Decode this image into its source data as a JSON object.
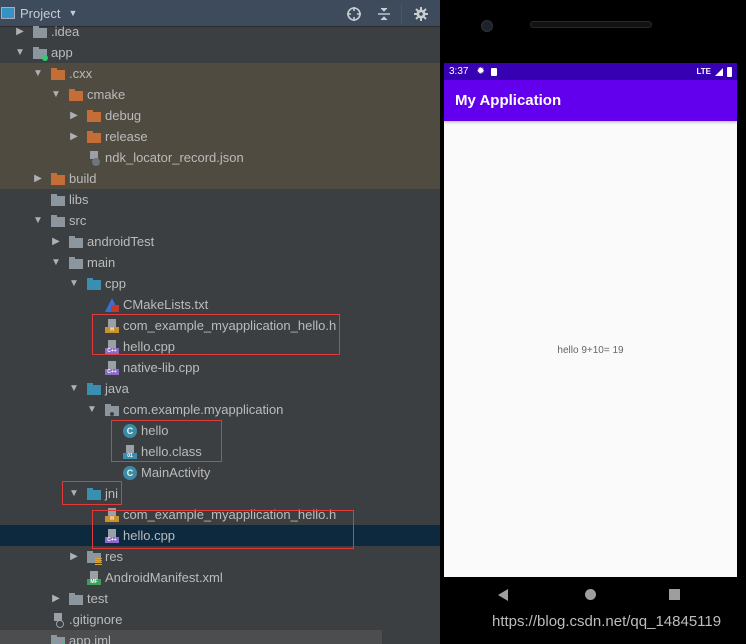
{
  "project_panel": {
    "title": "Project",
    "tools": [
      "locate-icon",
      "collapse-all-icon",
      "settings-icon"
    ]
  },
  "tree": [
    {
      "label": ".idea",
      "depth": 1,
      "arrow": "collapsed",
      "icon": "folder-gray",
      "bg": "normal"
    },
    {
      "label": "app",
      "depth": 1,
      "arrow": "expanded",
      "icon": "module-folder",
      "bg": "normal"
    },
    {
      "label": ".cxx",
      "depth": 2,
      "arrow": "expanded",
      "icon": "folder-orange",
      "bg": "excluded"
    },
    {
      "label": "cmake",
      "depth": 3,
      "arrow": "expanded",
      "icon": "folder-orange",
      "bg": "excluded"
    },
    {
      "label": "debug",
      "depth": 4,
      "arrow": "collapsed",
      "icon": "folder-orange",
      "bg": "excluded"
    },
    {
      "label": "release",
      "depth": 4,
      "arrow": "collapsed",
      "icon": "folder-orange",
      "bg": "excluded"
    },
    {
      "label": "ndk_locator_record.json",
      "depth": 4,
      "arrow": "none",
      "icon": "json-file",
      "bg": "excluded"
    },
    {
      "label": "build",
      "depth": 2,
      "arrow": "collapsed",
      "icon": "folder-orange",
      "bg": "excluded"
    },
    {
      "label": "libs",
      "depth": 2,
      "arrow": "none",
      "icon": "folder-gray",
      "bg": "normal"
    },
    {
      "label": "src",
      "depth": 2,
      "arrow": "expanded",
      "icon": "folder-gray",
      "bg": "normal"
    },
    {
      "label": "androidTest",
      "depth": 3,
      "arrow": "collapsed",
      "icon": "folder-gray",
      "bg": "normal"
    },
    {
      "label": "main",
      "depth": 3,
      "arrow": "expanded",
      "icon": "folder-gray",
      "bg": "normal"
    },
    {
      "label": "cpp",
      "depth": 4,
      "arrow": "expanded",
      "icon": "folder-blue",
      "bg": "normal"
    },
    {
      "label": "CMakeLists.txt",
      "depth": 5,
      "arrow": "none",
      "icon": "cmake-file",
      "bg": "normal"
    },
    {
      "label": "com_example_myapplication_hello.h",
      "depth": 5,
      "arrow": "none",
      "icon": "h-file",
      "bg": "normal"
    },
    {
      "label": "hello.cpp",
      "depth": 5,
      "arrow": "none",
      "icon": "cpp-file",
      "bg": "normal"
    },
    {
      "label": "native-lib.cpp",
      "depth": 5,
      "arrow": "none",
      "icon": "cpp-file",
      "bg": "normal"
    },
    {
      "label": "java",
      "depth": 4,
      "arrow": "expanded",
      "icon": "folder-blue",
      "bg": "normal"
    },
    {
      "label": "com.example.myapplication",
      "depth": 5,
      "arrow": "expanded",
      "icon": "package-folder",
      "bg": "normal"
    },
    {
      "label": "hello",
      "depth": 6,
      "arrow": "none",
      "icon": "java-class",
      "bg": "normal"
    },
    {
      "label": "hello.class",
      "depth": 6,
      "arrow": "none",
      "icon": "class-file",
      "bg": "normal"
    },
    {
      "label": "MainActivity",
      "depth": 6,
      "arrow": "none",
      "icon": "java-class",
      "bg": "normal"
    },
    {
      "label": "jni",
      "depth": 4,
      "arrow": "expanded",
      "icon": "folder-blue",
      "bg": "normal"
    },
    {
      "label": "com_example_myapplication_hello.h",
      "depth": 5,
      "arrow": "none",
      "icon": "h-file",
      "bg": "normal"
    },
    {
      "label": "hello.cpp",
      "depth": 5,
      "arrow": "none",
      "icon": "cpp-file",
      "bg": "selected"
    },
    {
      "label": "res",
      "depth": 4,
      "arrow": "collapsed",
      "icon": "res-folder",
      "bg": "normal"
    },
    {
      "label": "AndroidManifest.xml",
      "depth": 4,
      "arrow": "none",
      "icon": "manifest-file",
      "bg": "normal"
    },
    {
      "label": "test",
      "depth": 3,
      "arrow": "collapsed",
      "icon": "folder-gray",
      "bg": "normal"
    },
    {
      "label": ".gitignore",
      "depth": 2,
      "arrow": "none",
      "icon": "gitignore-file",
      "bg": "normal"
    },
    {
      "label": "app.iml",
      "depth": 2,
      "arrow": "none",
      "icon": "iml-file",
      "bg": "last"
    }
  ],
  "file_tags": {
    "h": "H",
    "cpp": "C++",
    "class": "01",
    "manifest": "MF",
    "class_letter": "C"
  },
  "emulator": {
    "status_time": "3:37",
    "status_network": "LTE",
    "app_title": "My Application",
    "message": "hello 9+10= 19"
  },
  "colors": {
    "status_bar": "#3700b3",
    "app_bar": "#6200ee",
    "highlight_box": "#e03a3a",
    "selected_row": "#0d293e",
    "excluded_row": "#4f4b41"
  },
  "watermark": "https://blog.csdn.net/qq_14845119"
}
